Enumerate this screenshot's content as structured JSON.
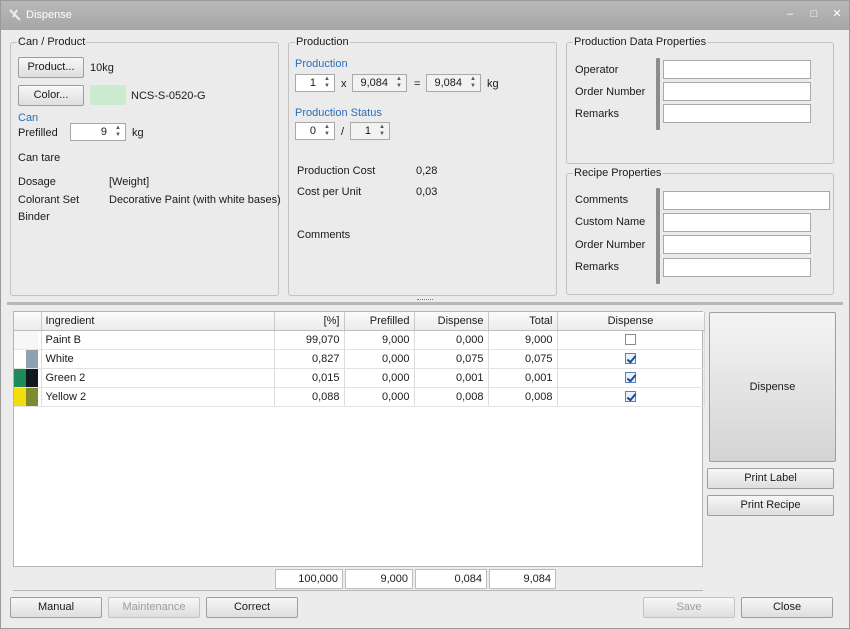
{
  "window": {
    "title": "Dispense",
    "minimize": "–",
    "maximize": "□",
    "close": "✕"
  },
  "can_product": {
    "title": "Can / Product",
    "product_button": "Product...",
    "product_value": "10kg",
    "color_button": "Color...",
    "color_swatch": "#ccead0",
    "color_value": "NCS-S-0520-G",
    "can_label": "Can",
    "prefilled_label": "Prefilled",
    "prefilled_value": "9",
    "prefilled_unit": "kg",
    "can_tare_label": "Can tare",
    "dosage_label": "Dosage",
    "dosage_value": "[Weight]",
    "colorant_set_label": "Colorant Set",
    "colorant_set_value": "Decorative Paint (with white bases)",
    "binder_label": "Binder"
  },
  "production": {
    "title": "Production",
    "production_label": "Production",
    "quantity": "1",
    "times": "x",
    "unit_amount": "9,084",
    "equals": "=",
    "total_amount": "9,084",
    "unit": "kg",
    "status_label": "Production Status",
    "status_done": "0",
    "slash": "/",
    "status_total": "1",
    "cost_label": "Production Cost",
    "cost_value": "0,28",
    "cost_unit_label": "Cost per Unit",
    "cost_unit_value": "0,03",
    "comments_label": "Comments"
  },
  "production_data_properties": {
    "title": "Production Data Properties",
    "operator_label": "Operator",
    "order_number_label": "Order Number",
    "remarks_label": "Remarks"
  },
  "recipe_properties": {
    "title": "Recipe Properties",
    "comments_label": "Comments",
    "custom_name_label": "Custom Name",
    "order_number_label": "Order Number",
    "remarks_label": "Remarks"
  },
  "grid": {
    "columns": [
      "Ingredient",
      "[%]",
      "Prefilled",
      "Dispense",
      "Total",
      "Dispense"
    ],
    "rows": [
      {
        "name": "Paint B",
        "pct": "99,070",
        "prefilled": "9,000",
        "dispense": "0,000",
        "total": "9,000",
        "checked": false,
        "color1": "#f7f7f7",
        "color2": "#f7f7f7"
      },
      {
        "name": "White",
        "pct": "0,827",
        "prefilled": "0,000",
        "dispense": "0,075",
        "total": "0,075",
        "checked": true,
        "color1": "#ffffff",
        "color2": "#8fa2b2"
      },
      {
        "name": "Green 2",
        "pct": "0,015",
        "prefilled": "0,000",
        "dispense": "0,001",
        "total": "0,001",
        "checked": true,
        "color1": "#1f8a5a",
        "color2": "#101820"
      },
      {
        "name": "Yellow 2",
        "pct": "0,088",
        "prefilled": "0,000",
        "dispense": "0,008",
        "total": "0,008",
        "checked": true,
        "color1": "#f2dd10",
        "color2": "#7d8a30"
      }
    ],
    "totals": {
      "pct": "100,000",
      "prefilled": "9,000",
      "dispense": "0,084",
      "total": "9,084"
    }
  },
  "side_buttons": {
    "dispense": "Dispense",
    "print_label": "Print Label",
    "print_recipe": "Print Recipe"
  },
  "bottom_buttons": {
    "manual": "Manual",
    "maintenance": "Maintenance",
    "correct": "Correct",
    "save": "Save",
    "close": "Close"
  }
}
